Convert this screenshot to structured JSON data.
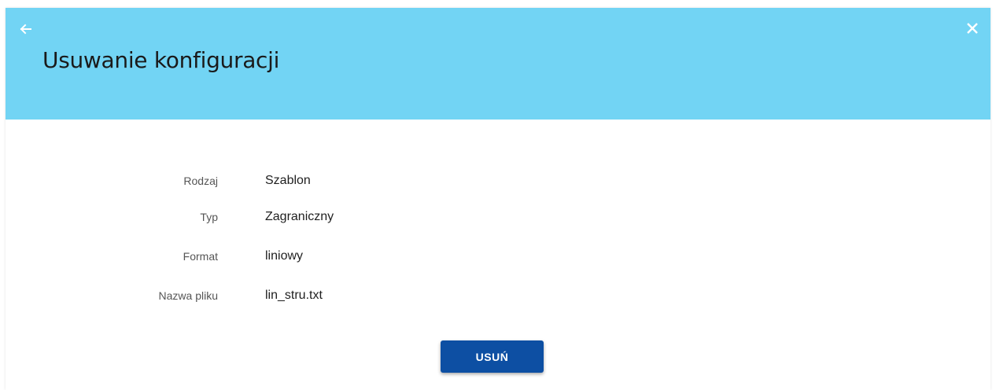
{
  "header": {
    "title": "Usuwanie konfiguracji",
    "back_icon": "arrow-left-icon",
    "close_icon": "close-icon",
    "background_color": "#72d4f4"
  },
  "details": [
    {
      "label": "Rodzaj",
      "value": "Szablon"
    },
    {
      "label": "Typ",
      "value": "Zagraniczny"
    },
    {
      "label": "Format",
      "value": "liniowy"
    },
    {
      "label": "Nazwa pliku",
      "value": "lin_stru.txt"
    }
  ],
  "actions": {
    "delete_label": "USUŃ",
    "delete_color": "#0d4fa3"
  }
}
